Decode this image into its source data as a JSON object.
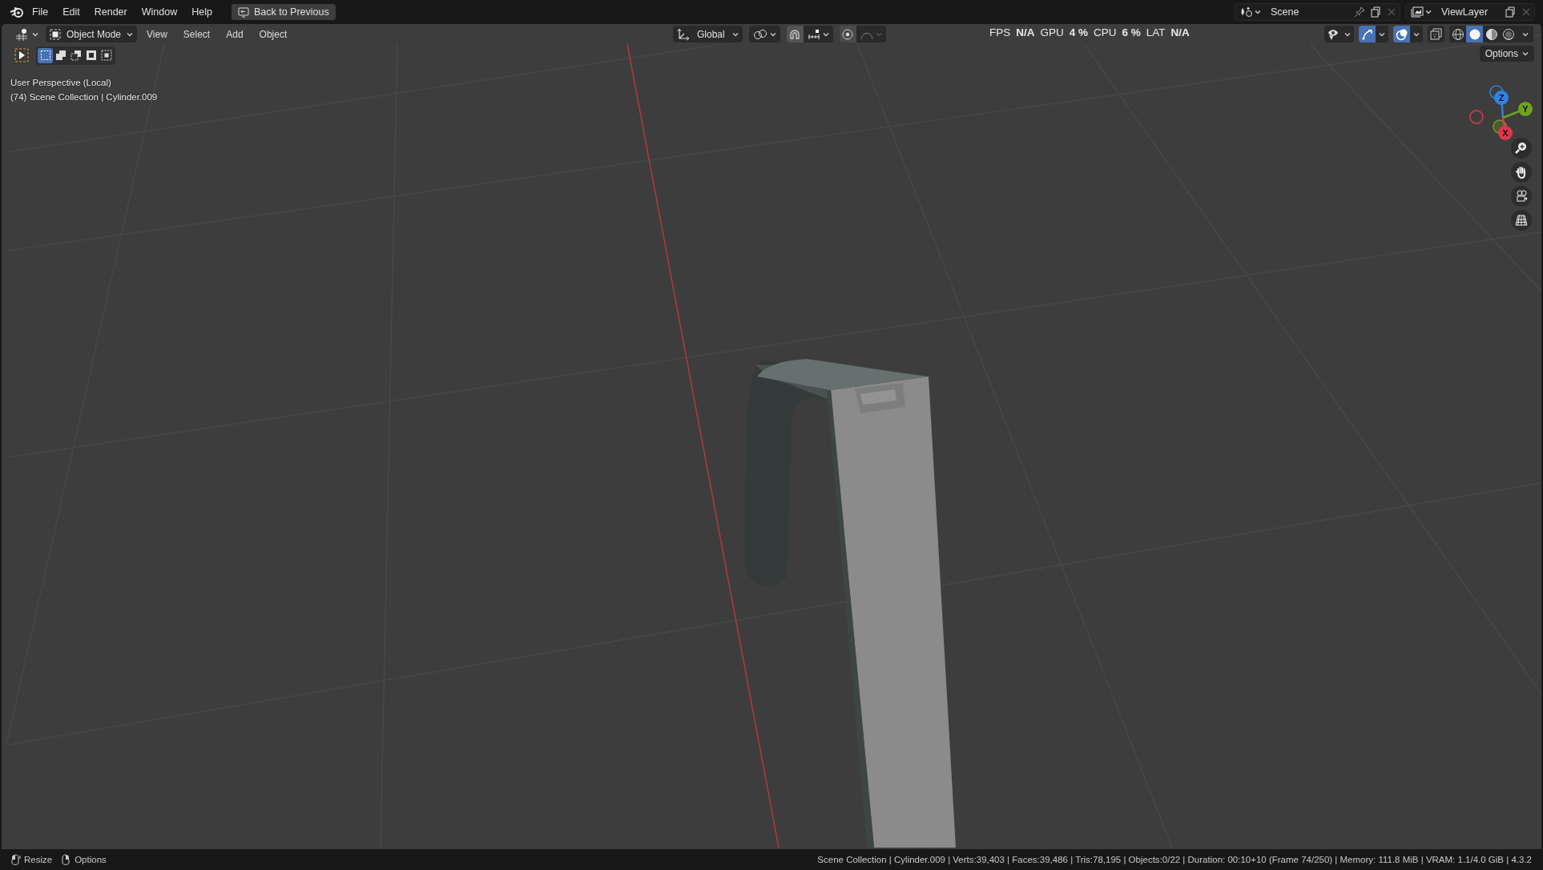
{
  "menu_bar": {
    "menus": [
      "File",
      "Edit",
      "Render",
      "Window",
      "Help"
    ],
    "back_button": "Back to Previous"
  },
  "scene_selector": {
    "value": "Scene"
  },
  "view_layer_selector": {
    "value": "ViewLayer"
  },
  "viewport_header": {
    "mode": "Object Mode",
    "menus": [
      "View",
      "Select",
      "Add",
      "Object"
    ],
    "orientation": "Global"
  },
  "performance_stats": [
    {
      "label": "FPS",
      "value": "N/A"
    },
    {
      "label": "GPU",
      "value": "4 %"
    },
    {
      "label": "CPU",
      "value": "6 %"
    },
    {
      "label": "LAT",
      "value": "N/A"
    }
  ],
  "viewport_toggles": [
    {
      "kind": "visibility",
      "on": false
    },
    {
      "kind": "gizmos",
      "on": true
    },
    {
      "kind": "overlays",
      "on": true
    },
    {
      "kind": "xray",
      "on": false
    }
  ],
  "shading_modes": [
    {
      "kind": "wireframe",
      "selected": false
    },
    {
      "kind": "solid",
      "selected": true
    },
    {
      "kind": "material",
      "selected": false
    },
    {
      "kind": "rendered",
      "selected": false
    }
  ],
  "select_modes": [
    {
      "kind": "set",
      "selected": true
    },
    {
      "kind": "extend",
      "selected": false
    },
    {
      "kind": "subtract",
      "selected": false
    },
    {
      "kind": "invert",
      "selected": false
    },
    {
      "kind": "intersect",
      "selected": false
    }
  ],
  "options_button": "Options",
  "viewport_info": [
    "User Perspective (Local)",
    "(74) Scene Collection | Cylinder.009"
  ],
  "navigation_gizmo": {
    "axes": [
      {
        "label": "Z",
        "color": "#2f83e6"
      },
      {
        "label": "Y",
        "color": "#6ea31c"
      },
      {
        "label": "X",
        "color": "#e4354f"
      }
    ]
  },
  "status_bar": {
    "hints": [
      {
        "kind": "left-mouse",
        "label": "Resize"
      },
      {
        "kind": "right-mouse",
        "label": "Options"
      }
    ],
    "stats": "Scene Collection | Cylinder.009 | Verts:39,403 | Faces:39,486 | Tris:78,195 | Objects:0/22 | Duration: 00:10+10 (Frame 74/250) | Memory: 111.8 MiB | VRAM: 1.1/4.0 GiB | 4.3.2"
  }
}
